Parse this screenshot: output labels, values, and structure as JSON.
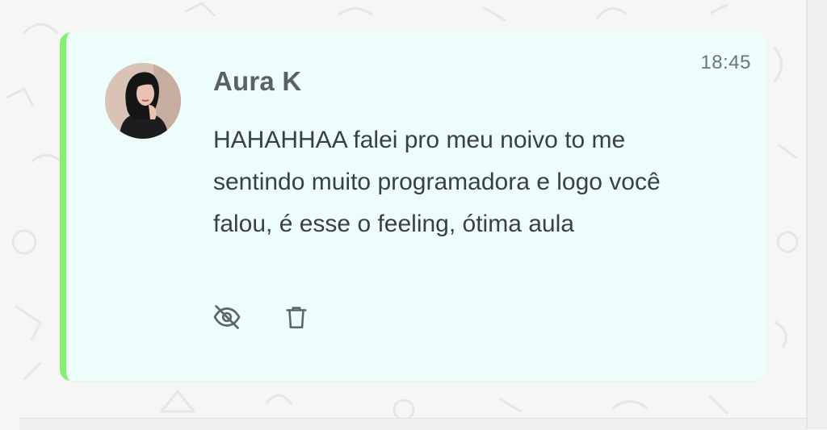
{
  "message": {
    "author": "Aura K",
    "time": "18:45",
    "text": "HAHAHHAA falei pro meu noivo to me sentindo muito programadora e logo você falou, é esse o feeling, ótima aula"
  },
  "actions": {
    "hide_icon": "eye-off-icon",
    "delete_icon": "trash-icon"
  },
  "colors": {
    "accent_bar": "#86f06e",
    "card_bg": "#edfdfb",
    "author_text": "#5b5f66",
    "body_text": "#3b3f45"
  }
}
